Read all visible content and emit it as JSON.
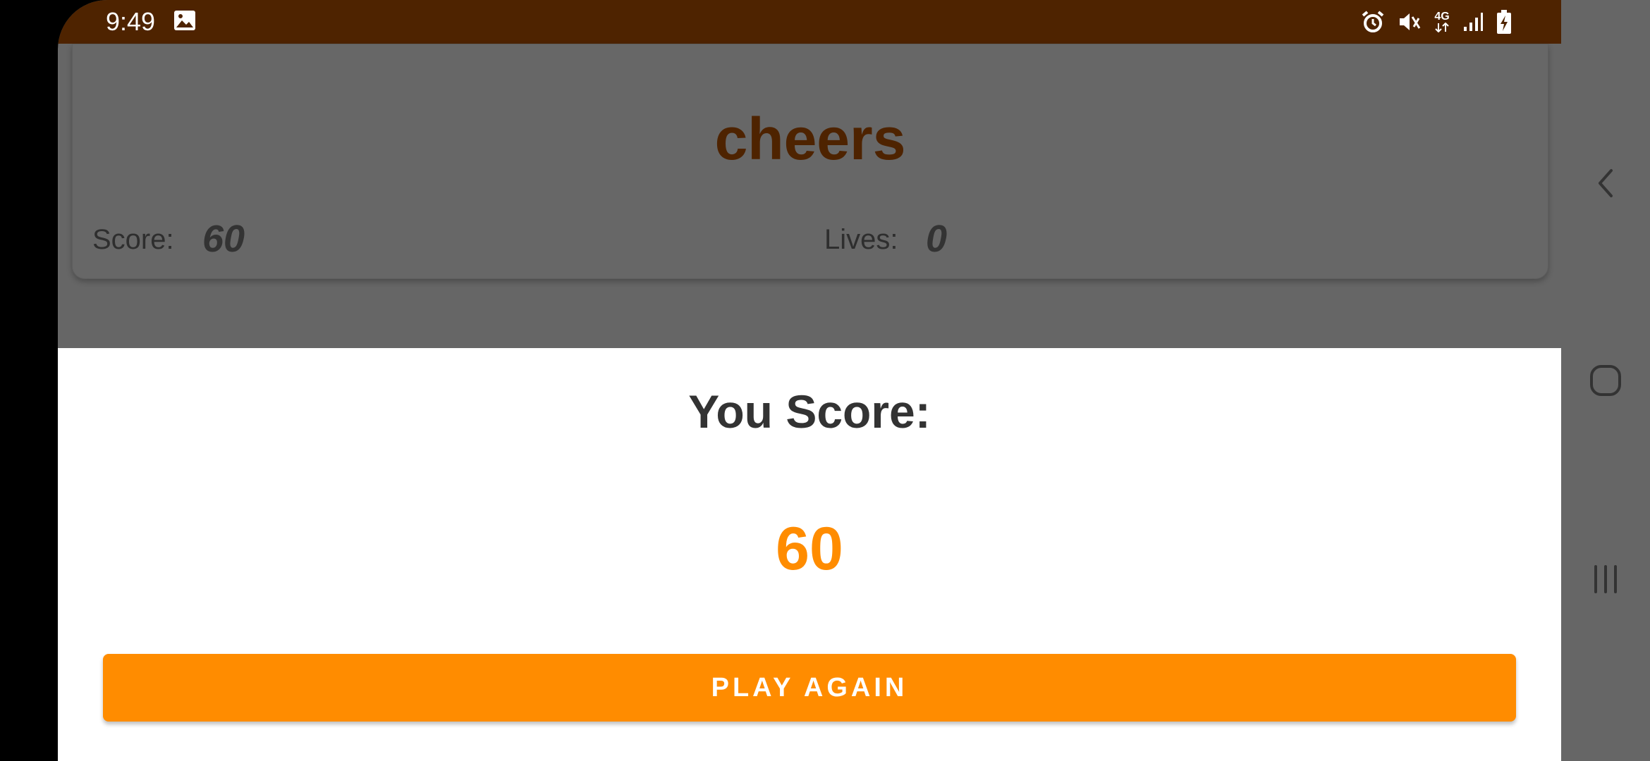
{
  "status_bar": {
    "time": "9:49",
    "network": "4G",
    "icons": [
      "gallery-icon",
      "alarm-icon",
      "mute-icon",
      "network-4g-icon",
      "signal-icon",
      "battery-charging-icon"
    ],
    "background": "#4e2300"
  },
  "game": {
    "word": "cheers",
    "score_label": "Score:",
    "score_value": "60",
    "lives_label": "Lives:",
    "lives_value": "0"
  },
  "dialog": {
    "title": "You Score:",
    "score": "60",
    "play_again_label": "PLAY AGAIN"
  },
  "navigation": {
    "icons": [
      "back-icon",
      "home-icon",
      "recent-apps-icon"
    ]
  },
  "colors": {
    "accent": "#ff8c00",
    "word": "#4e2300",
    "overlay": "#666666"
  }
}
